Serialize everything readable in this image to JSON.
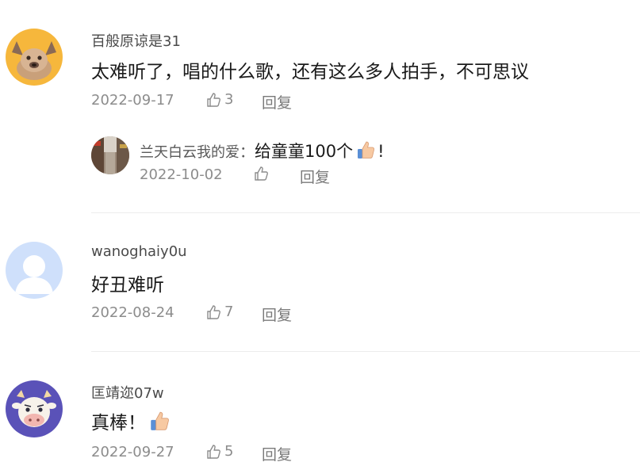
{
  "comments": [
    {
      "username": "百般原谅是31",
      "text": "太难听了，唱的什么歌，还有这么多人拍手，不可思议",
      "date": "2022-09-17",
      "likes": "3",
      "reply_label": "回复",
      "avatar_icon": "dog-avatar",
      "reply": {
        "username": "兰天白云我的爱",
        "separator": "：",
        "text": "给童童100个",
        "text_suffix": "!",
        "emoji_icon": "thumbs-up-emoji",
        "date": "2022-10-02",
        "likes": "",
        "reply_label": "回复",
        "avatar_icon": "street-photo-avatar"
      }
    },
    {
      "username": "wanoghaiy0u",
      "text": "好丑难听",
      "date": "2022-08-24",
      "likes": "7",
      "reply_label": "回复",
      "avatar_icon": "default-user-avatar"
    },
    {
      "username": "匡靖迩07w",
      "text": "真棒！",
      "emoji_icon": "thumbs-up-emoji",
      "date": "2022-09-27",
      "likes": "5",
      "reply_label": "回复",
      "avatar_icon": "cartoon-cow-avatar"
    }
  ],
  "colors": {
    "meta_text": "#8c8c8c",
    "divider": "#ececec",
    "avatar_dog_bg": "#f6b73c",
    "avatar_default_bg": "#cfe0fb",
    "avatar_cow_bg": "#5a52b8"
  }
}
